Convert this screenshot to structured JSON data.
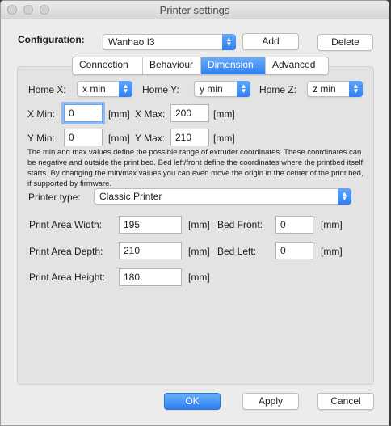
{
  "window": {
    "title": "Printer settings"
  },
  "configuration": {
    "label": "Configuration:",
    "value": "Wanhao I3",
    "add_label": "Add",
    "delete_label": "Delete"
  },
  "tabs": [
    {
      "label": "Connection"
    },
    {
      "label": "Behaviour"
    },
    {
      "label": "Dimension"
    },
    {
      "label": "Advanced"
    }
  ],
  "home": {
    "x_label": "Home X:",
    "x_value": "x min",
    "y_label": "Home Y:",
    "y_value": "y min",
    "z_label": "Home Z:",
    "z_value": "z min"
  },
  "limits": {
    "xmin_label": "X Min:",
    "xmin_value": "0",
    "xmax_label": "X Max:",
    "xmax_value": "200",
    "ymin_label": "Y Min:",
    "ymin_value": "0",
    "ymax_label": "Y Max:",
    "ymax_value": "210",
    "unit": "[mm]"
  },
  "note": "The min and max values define the possible range of extruder coordinates. These coordinates can be negative and outside the print bed. Bed left/front define the coordinates where the printbed itself starts. By changing the min/max values you can even move the origin in the center of the print bed, if supported by firmware.",
  "printer_type": {
    "label": "Printer type:",
    "value": "Classic Printer"
  },
  "area": {
    "width_label": "Print Area Width:",
    "width_value": "195",
    "depth_label": "Print Area Depth:",
    "depth_value": "210",
    "height_label": "Print Area Height:",
    "height_value": "180",
    "bed_front_label": "Bed Front:",
    "bed_front_value": "0",
    "bed_left_label": "Bed Left:",
    "bed_left_value": "0",
    "unit": "[mm]"
  },
  "footer": {
    "ok_label": "OK",
    "apply_label": "Apply",
    "cancel_label": "Cancel"
  }
}
